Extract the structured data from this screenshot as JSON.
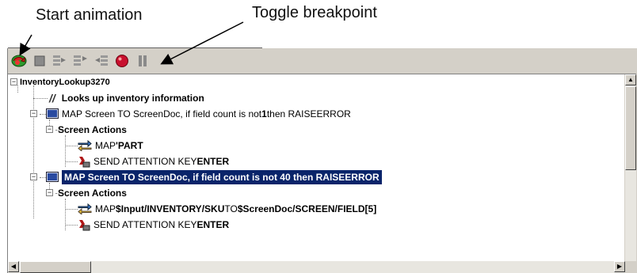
{
  "callouts": {
    "start": "Start animation",
    "toggle": "Toggle breakpoint"
  },
  "toolbar": [
    {
      "name": "start-animation-button",
      "icon": "start-animation-icon"
    },
    {
      "name": "stop-button",
      "icon": "stop-icon"
    },
    {
      "name": "step-into-button",
      "icon": "step-into-icon"
    },
    {
      "name": "step-over-button",
      "icon": "step-over-icon"
    },
    {
      "name": "step-out-button",
      "icon": "step-out-icon"
    },
    {
      "name": "toggle-breakpoint-button",
      "icon": "breakpoint-icon"
    },
    {
      "name": "pause-button",
      "icon": "pause-icon"
    }
  ],
  "tree": {
    "root": "InventoryLookup3270",
    "comment": "Looks up inventory information",
    "map1": {
      "prefix": "MAP Screen TO ScreenDoc, if field count is not ",
      "count": "1",
      "suffix": " then RAISEERROR"
    },
    "actions1": "Screen Actions",
    "map_part": {
      "prefix": "MAP ",
      "value": "'PART"
    },
    "send1": {
      "prefix": "SEND ATTENTION KEY ",
      "key": "ENTER"
    },
    "map2": "MAP Screen TO ScreenDoc, if field count is not 40 then RAISEERROR",
    "actions2": "Screen Actions",
    "map_sku": {
      "prefix": "MAP ",
      "src": "$Input/INVENTORY/SKU",
      "mid": " TO ",
      "dst": "$ScreenDoc/SCREEN/FIELD[5]"
    },
    "send2": {
      "prefix": "SEND ATTENTION KEY ",
      "key": "ENTER"
    }
  },
  "colors": {
    "selection": "#0a246a",
    "window": "#d4d0c8"
  }
}
